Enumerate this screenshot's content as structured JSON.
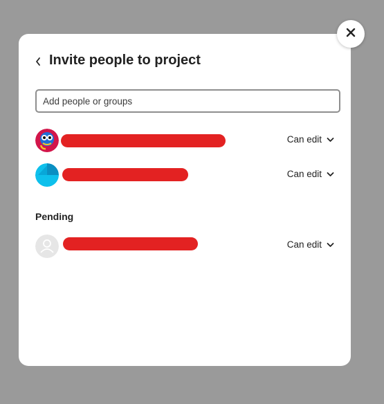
{
  "dialog": {
    "title": "Invite people to project",
    "search": {
      "placeholder": "Add people or groups",
      "value": ""
    },
    "members": [
      {
        "avatar": "colorful-character-avatar",
        "role": "Can edit"
      },
      {
        "avatar": "cyan-circle-avatar",
        "role": "Can edit"
      }
    ],
    "pending": {
      "heading": "Pending",
      "items": [
        {
          "avatar": "default-user-avatar",
          "role": "Can edit"
        }
      ]
    }
  },
  "colors": {
    "backdrop": "#9a9a9a",
    "redaction": "#e32222",
    "text": "#222222"
  }
}
